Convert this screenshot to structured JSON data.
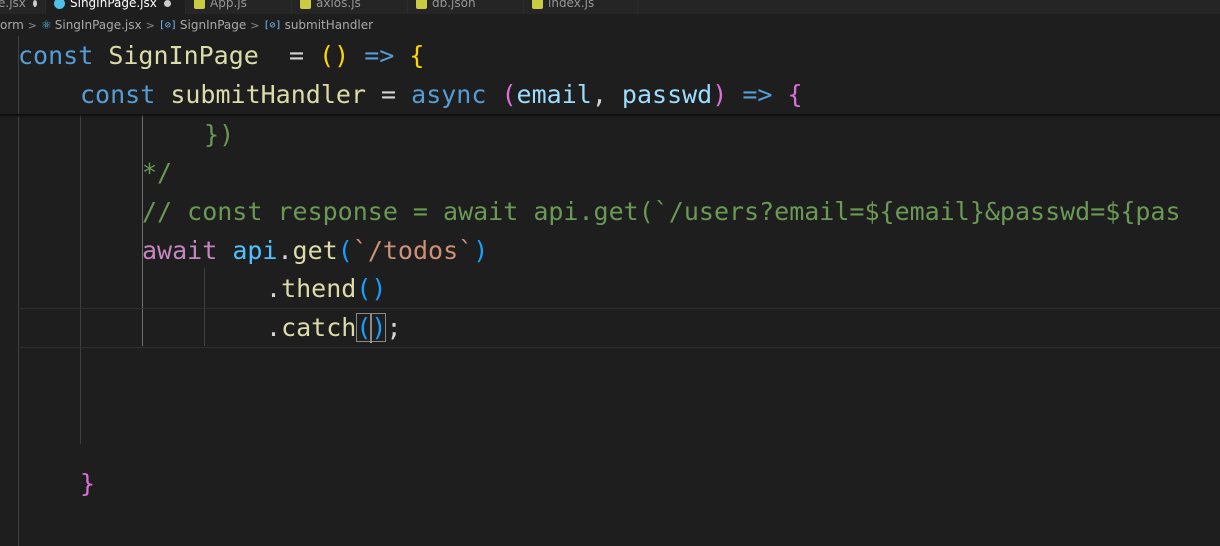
{
  "tabs": [
    {
      "label": "e.jsx",
      "icon": "react-file-icon",
      "dirty": true,
      "active": false
    },
    {
      "label": "SingInPage.jsx",
      "icon": "react-file-icon",
      "dirty": true,
      "active": true
    },
    {
      "label": "App.js",
      "icon": "js-file-icon",
      "dirty": false,
      "active": false
    },
    {
      "label": "axios.js",
      "icon": "js-file-icon",
      "dirty": false,
      "active": false
    },
    {
      "label": "db.json",
      "icon": "json-file-icon",
      "dirty": false,
      "active": false
    },
    {
      "label": "index.js",
      "icon": "js-file-icon",
      "dirty": false,
      "active": false
    }
  ],
  "breadcrumbs": {
    "folder": "orm",
    "file": "SingInPage.jsx",
    "component": "SignInPage",
    "function": "submitHandler",
    "separator": ">",
    "symbol_icon_glyph": "[⊘]"
  },
  "code": {
    "line1": {
      "kw": "const",
      "name": "SignInPage",
      "eq": "  = ",
      "parens": "()",
      "arrow": " => ",
      "brace": "{"
    },
    "line2": {
      "kw": "const",
      "name": "submitHandler",
      "eq": " = ",
      "async": "async",
      "open": "(",
      "p1": "email",
      "comma": ", ",
      "p2": "passwd",
      "close": ")",
      "arrow": " => ",
      "brace": "{"
    },
    "line3": {
      "brace": "}",
      "paren": ")"
    },
    "line4": {
      "comment": "*/"
    },
    "line5": {
      "comment": "// const response = await api.get(`/users?email=${email}&passwd=${pas"
    },
    "line6": {
      "await": "await",
      "obj": "api",
      "dot": ".",
      "method": "get",
      "open": "(",
      "str": "`/todos`",
      "close": ")"
    },
    "line7": {
      "dot": ".",
      "method": "thend",
      "parens": "()"
    },
    "line8": {
      "dot": ".",
      "method": "catch",
      "open": "(",
      "close": ")",
      "semi": ";"
    },
    "line12": {
      "brace": "}"
    }
  },
  "colors": {
    "background": "#1e1e1e",
    "keyword": "#569cd6",
    "function": "#dcdcaa",
    "variable": "#9cdcfe",
    "control": "#c586c0",
    "string": "#ce9178",
    "comment": "#6a9955",
    "bracket_gold": "#ffd700",
    "bracket_orchid": "#da70d6",
    "bracket_blue": "#179fff"
  }
}
